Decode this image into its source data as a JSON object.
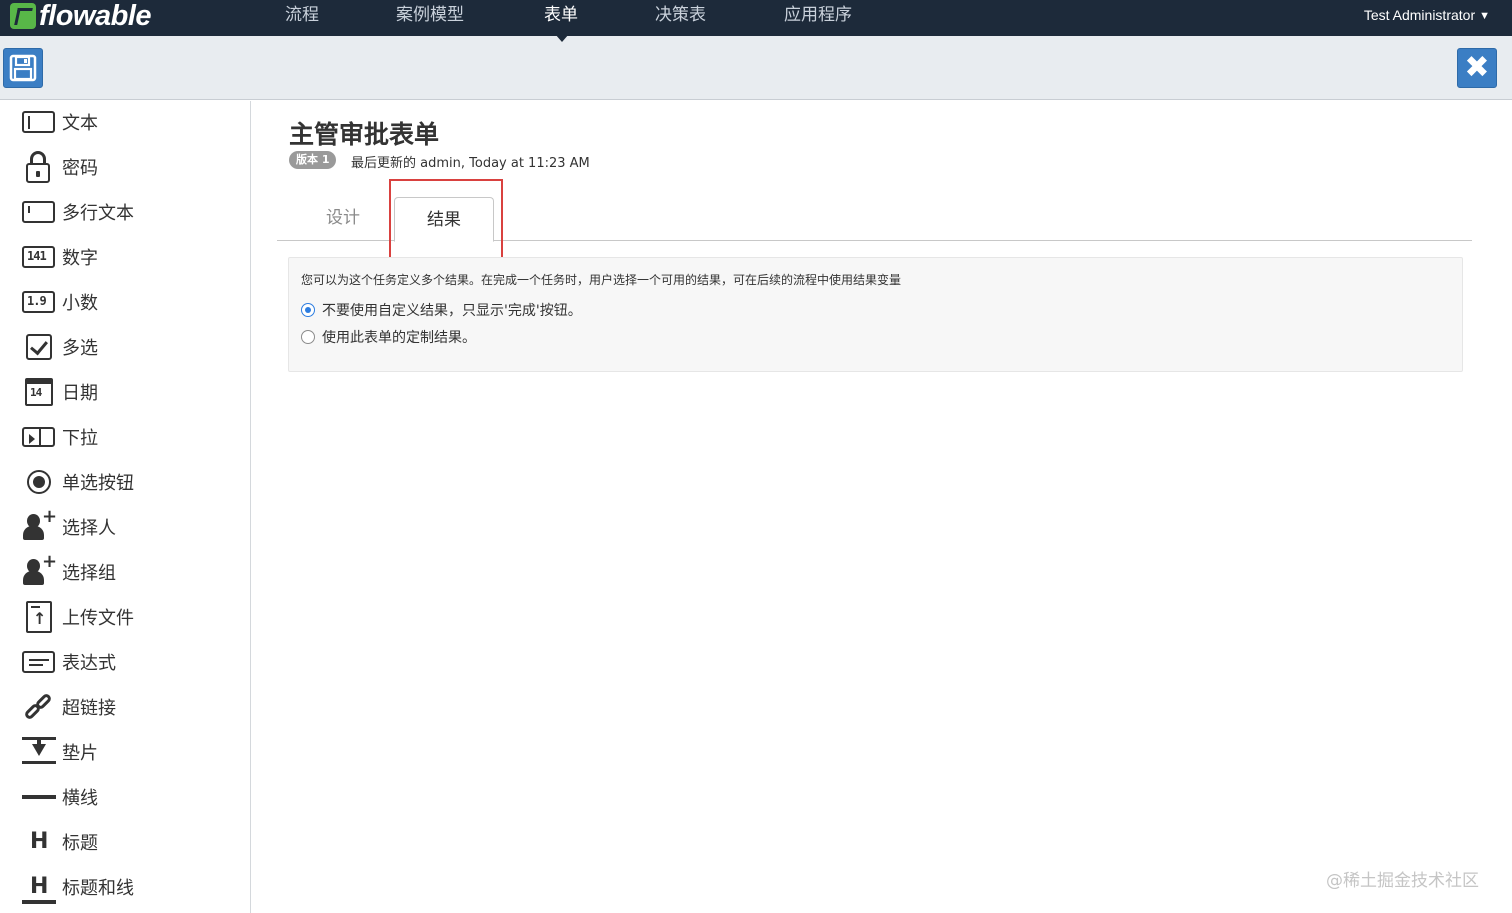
{
  "nav": {
    "logo": "flowable",
    "items": [
      "流程",
      "案例模型",
      "表单",
      "决策表",
      "应用程序"
    ],
    "active_index": 2,
    "user": "Test Administrator"
  },
  "toolbar": {
    "save_icon": "save-icon",
    "close_icon": "close-icon",
    "accent_color": "#3b7ec4"
  },
  "palette": {
    "items": [
      {
        "label": "文本",
        "icon": "text-field-icon"
      },
      {
        "label": "密码",
        "icon": "lock-icon"
      },
      {
        "label": "多行文本",
        "icon": "textarea-icon"
      },
      {
        "label": "数字",
        "icon": "number-icon",
        "icon_text": "141"
      },
      {
        "label": "小数",
        "icon": "decimal-icon",
        "icon_text": "1.9"
      },
      {
        "label": "多选",
        "icon": "checkbox-icon"
      },
      {
        "label": "日期",
        "icon": "calendar-icon",
        "icon_text": "14"
      },
      {
        "label": "下拉",
        "icon": "dropdown-icon"
      },
      {
        "label": "单选按钮",
        "icon": "radio-icon"
      },
      {
        "label": "选择人",
        "icon": "add-person-icon"
      },
      {
        "label": "选择组",
        "icon": "add-group-icon"
      },
      {
        "label": "上传文件",
        "icon": "upload-file-icon"
      },
      {
        "label": "表达式",
        "icon": "expression-icon"
      },
      {
        "label": "超链接",
        "icon": "link-icon"
      },
      {
        "label": "垫片",
        "icon": "spacer-icon"
      },
      {
        "label": "横线",
        "icon": "horizontal-line-icon"
      },
      {
        "label": "标题",
        "icon": "heading-icon",
        "icon_text": "H"
      },
      {
        "label": "标题和线",
        "icon": "heading-line-icon",
        "icon_text": "H"
      }
    ]
  },
  "form": {
    "title": "主管审批表单",
    "version_badge": "版本 1",
    "updated_text": "最后更新的 admin, Today at 11:23 AM"
  },
  "tabs": {
    "design": "设计",
    "outcomes": "结果",
    "active": "outcomes",
    "highlight_color": "#d9413f"
  },
  "outcomes": {
    "description": "您可以为这个任务定义多个结果。在完成一个任务时，用户选择一个可用的结果，可在后续的流程中使用结果变量",
    "options": [
      {
        "label": "不要使用自定义结果，只显示'完成'按钮。",
        "checked": true
      },
      {
        "label": "使用此表单的定制结果。",
        "checked": false
      }
    ]
  },
  "watermark": "@稀土掘金技术社区"
}
